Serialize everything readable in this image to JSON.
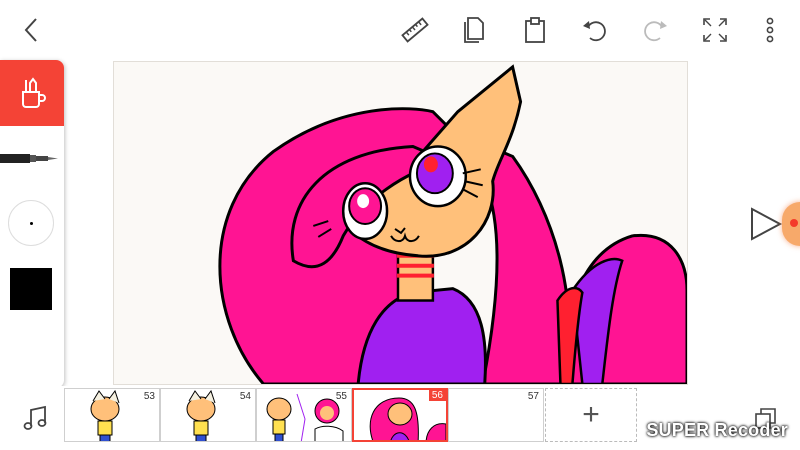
{
  "colors": {
    "accent": "#f44336",
    "hair": "#ff1493",
    "skin": "#ffc07a",
    "shirt": "#a020f0",
    "current_color": "#000000"
  },
  "topbar": {
    "icons": [
      "back-icon",
      "ruler-icon",
      "copy-icon",
      "paste-icon",
      "undo-icon",
      "redo-icon",
      "fullscreen-icon",
      "more-icon"
    ]
  },
  "tools": {
    "active_tool_icon": "pen-cup-icon",
    "brush_icon": "pen-icon"
  },
  "timeline": {
    "frames": [
      {
        "number": "53"
      },
      {
        "number": "54"
      },
      {
        "number": "55"
      },
      {
        "number": "56"
      },
      {
        "number": "57"
      }
    ],
    "add_label": "+"
  },
  "watermark": "SUPER Recoder"
}
